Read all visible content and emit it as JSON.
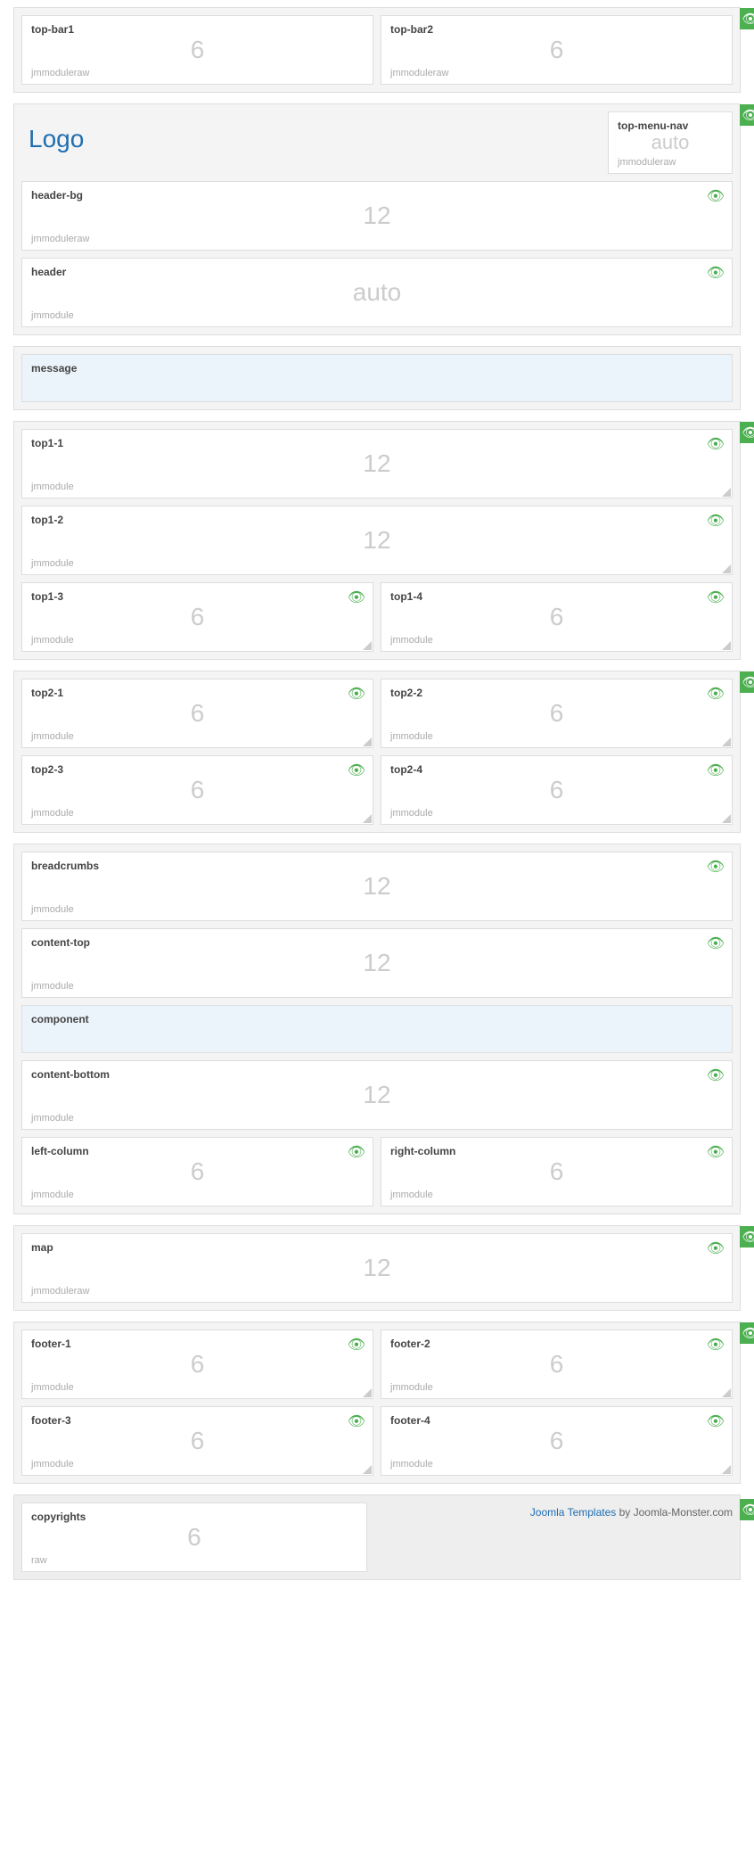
{
  "logo": "Logo",
  "credits": {
    "link": "Joomla Templates",
    "rest": " by Joomla-Monster.com"
  },
  "topbar": [
    {
      "name": "top-bar1",
      "size": "6",
      "type": "jmmoduleraw"
    },
    {
      "name": "top-bar2",
      "size": "6",
      "type": "jmmoduleraw"
    }
  ],
  "topmenu": {
    "name": "top-menu-nav",
    "size": "auto",
    "type": "jmmoduleraw"
  },
  "headerbg": {
    "name": "header-bg",
    "size": "12",
    "type": "jmmoduleraw"
  },
  "header": {
    "name": "header",
    "size": "auto",
    "type": "jmmodule"
  },
  "message": {
    "name": "message"
  },
  "top1": [
    {
      "name": "top1-1",
      "size": "12",
      "type": "jmmodule"
    },
    {
      "name": "top1-2",
      "size": "12",
      "type": "jmmodule"
    },
    {
      "name": "top1-3",
      "size": "6",
      "type": "jmmodule"
    },
    {
      "name": "top1-4",
      "size": "6",
      "type": "jmmodule"
    }
  ],
  "top2": [
    {
      "name": "top2-1",
      "size": "6",
      "type": "jmmodule"
    },
    {
      "name": "top2-2",
      "size": "6",
      "type": "jmmodule"
    },
    {
      "name": "top2-3",
      "size": "6",
      "type": "jmmodule"
    },
    {
      "name": "top2-4",
      "size": "6",
      "type": "jmmodule"
    }
  ],
  "content": {
    "breadcrumbs": {
      "name": "breadcrumbs",
      "size": "12",
      "type": "jmmodule"
    },
    "ctop": {
      "name": "content-top",
      "size": "12",
      "type": "jmmodule"
    },
    "component": {
      "name": "component"
    },
    "cbottom": {
      "name": "content-bottom",
      "size": "12",
      "type": "jmmodule"
    },
    "left": {
      "name": "left-column",
      "size": "6",
      "type": "jmmodule"
    },
    "right": {
      "name": "right-column",
      "size": "6",
      "type": "jmmodule"
    }
  },
  "map": {
    "name": "map",
    "size": "12",
    "type": "jmmoduleraw"
  },
  "footer": [
    {
      "name": "footer-1",
      "size": "6",
      "type": "jmmodule"
    },
    {
      "name": "footer-2",
      "size": "6",
      "type": "jmmodule"
    },
    {
      "name": "footer-3",
      "size": "6",
      "type": "jmmodule"
    },
    {
      "name": "footer-4",
      "size": "6",
      "type": "jmmodule"
    }
  ],
  "copyrights": {
    "name": "copyrights",
    "size": "6",
    "type": "raw"
  }
}
